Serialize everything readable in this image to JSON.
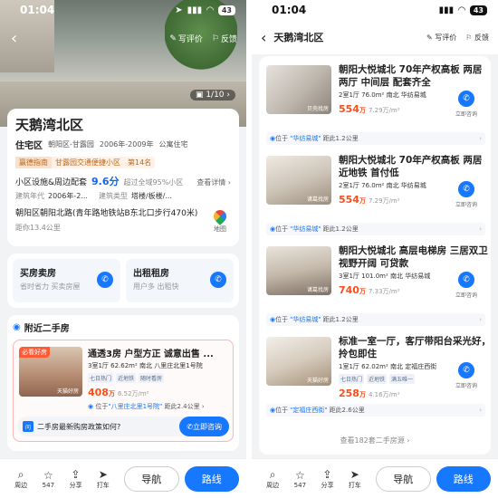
{
  "status": {
    "time": "01:04",
    "battery": "43"
  },
  "left": {
    "toolbar": {
      "write_review": "写评价",
      "feedback": "反馈"
    },
    "pager": "1/10",
    "title": "天鹅湾北区",
    "type": "住宅区",
    "district": "朝阳区-甘露园",
    "years": "2006年-2009年",
    "housing": "公寓住宅",
    "rank_label": "赢德指南",
    "rank_text": "甘露园交通便捷小区",
    "rank_no": "第14名",
    "facility_label": "小区设施&周边配套",
    "score": "9.6分",
    "score_note": "超过全域95%小区",
    "detail_link": "查看详情",
    "build_year_label": "建筑年代",
    "build_year": "2006年-2...",
    "build_type_label": "建筑类型",
    "build_type": "塔楼/板楼/...",
    "address": "朝阳区朝阳北路(青年路地铁站B东北口步行470米)",
    "distance": "距你13.4公里",
    "map_label": "地图",
    "sell": {
      "title": "买房卖房",
      "sub": "省时省力 买卖房屋"
    },
    "rent": {
      "title": "出租租房",
      "sub": "用户多 出租快"
    },
    "nearby_title": "附近二手房",
    "house": {
      "badge": "必看好房",
      "watermark": "天猫好房",
      "title": "通透3房 户型方正 诚意出售 ...",
      "meta": "3室1厅  62.62m²  南北  八里庄北里1号院",
      "tags": [
        "七日热门",
        "近地铁",
        "随时看房"
      ],
      "price": "408",
      "price_unit": "万",
      "unit_price": "6.52万/m²",
      "location_prefix": "位于",
      "location": "\"八里庄北里1号院\"",
      "location_dist": "距此2.4公里"
    },
    "question": "二手房最新购房政策如何?",
    "question_icon": "问",
    "consult": "立即咨询",
    "bottom": [
      {
        "icon": "⌕",
        "label": "周边"
      },
      {
        "icon": "☆",
        "label": "547"
      },
      {
        "icon": "⇪",
        "label": "分享"
      },
      {
        "icon": "➤",
        "label": "打车"
      }
    ],
    "nav": "导航",
    "route": "路线"
  },
  "right": {
    "title": "天鹅湾北区",
    "toolbar": {
      "write_review": "写评价",
      "feedback": "反馈"
    },
    "listings": [
      {
        "title": "朝阳大悦城北 70年产权高板 两居两厅  中间层  配套齐全",
        "meta": "2室1厅  76.0m²  南北  华纺易城",
        "tags": [],
        "price": "554",
        "unit_price": "7.29万/m²",
        "location": "\"华纺易城\"",
        "dist": "距此1.2公里",
        "watermark": "贝壳找房"
      },
      {
        "title": "朝阳大悦城北 70年产权高板 两居近地铁 首付低",
        "meta": "2室1厅  76.0m²  南北  华纺易城",
        "tags": [],
        "price": "554",
        "unit_price": "7.29万/m²",
        "location": "\"华纺易城\"",
        "dist": "距此1.2公里",
        "watermark": "诸葛找房"
      },
      {
        "title": "朝阳大悦城北 高层电梯房 三居双卫 视野开阔 可贷款",
        "meta": "3室1厅  101.0m²  南北  华纺易城",
        "tags": [],
        "price": "740",
        "unit_price": "7.33万/m²",
        "location": "\"华纺易城\"",
        "dist": "距此1.2公里",
        "watermark": "诸葛找房"
      },
      {
        "title": "标准一室一厅，客厅带阳台采光好，拎包即住",
        "meta": "1室1厅  62.02m²  南北  定福庄西街",
        "tags": [
          "七日热门",
          "近地铁",
          "满五唯一"
        ],
        "price": "258",
        "unit_price": "4.16万/m²",
        "location": "\"定福庄西街\"",
        "dist": "距此2.6公里",
        "watermark": "天猫好房"
      }
    ],
    "call_label": "立即咨询",
    "location_prefix": "位于",
    "price_unit": "万",
    "more": "查看182套二手房源"
  },
  "colors": {
    "accent": "#1677ff",
    "price": "#ff4d1a"
  }
}
